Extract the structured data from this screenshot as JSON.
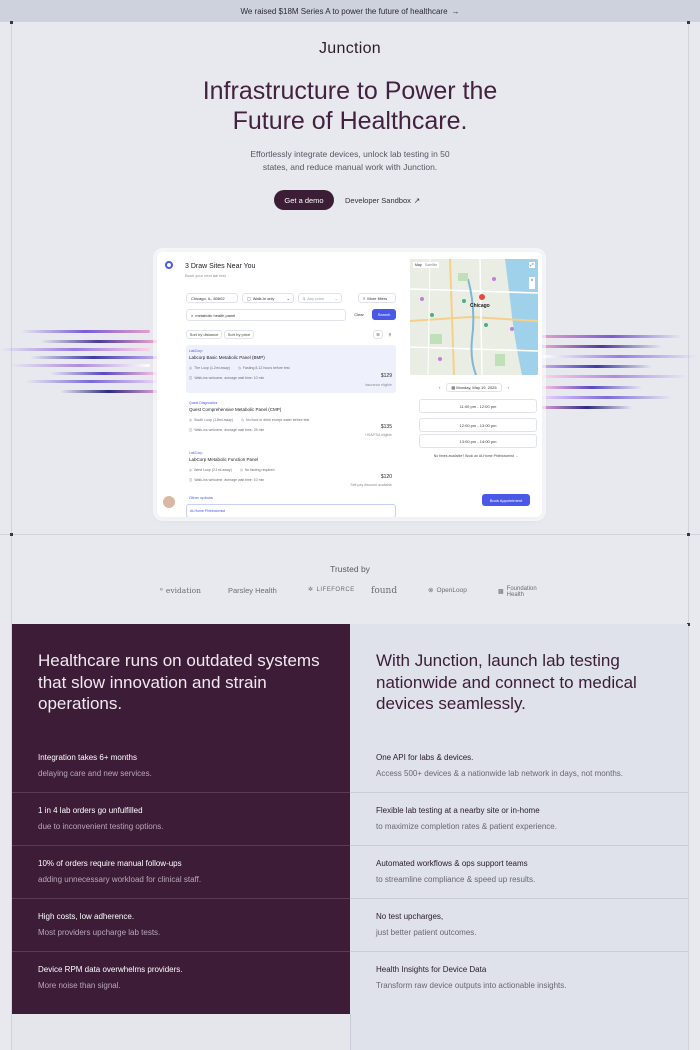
{
  "announcement": {
    "text": "We raised $18M Series A to power the future of healthcare",
    "arrow": "→"
  },
  "header": {
    "logo": "Junction"
  },
  "hero": {
    "title_line1": "Infrastructure to Power the",
    "title_line2": "Future of Healthcare.",
    "sub_line1": "Effortlessly integrate devices, unlock lab testing in 50",
    "sub_line2": "states, and reduce manual work with Junction.",
    "demo_label": "Get a demo",
    "sandbox_label": "Developer Sandbox",
    "sandbox_arrow": "↗"
  },
  "app": {
    "title": "3 Draw Sites Near You",
    "subtitle": "Book your next lab test",
    "location": "Chicago, IL, 60602",
    "walkin": "Walk-in only",
    "price": "Any price",
    "more_filters": "More filters",
    "search_value": "metabolic health panel",
    "clear_label": "Clear",
    "search_label": "Search",
    "sort_distance": "Sort by distance",
    "sort_price": "Sort by price",
    "results": [
      {
        "lab": "LabCorp",
        "name": "Labcorp Basic Metabolic Panel (BMP)",
        "distance": "The Loop (1.2mi away)",
        "req": "Fasting 8-12 hours before test",
        "wait": "Walk-ins welcome, average wait time: 10 min",
        "price": "$129",
        "note": "Insurance eligible"
      },
      {
        "lab": "Quest Diagnostics",
        "name": "Quest Comprehensive Metabolic Panel (CMP)",
        "distance": "South Loop (1.8mi away)",
        "req": "No food or drink except water before test",
        "wait": "Walk-ins welcome, average wait time: 25 min",
        "price": "$135",
        "note": "HSA/FSA eligible"
      },
      {
        "lab": "LabCorp",
        "name": "LabCorp Metabolic Function Panel",
        "distance": "West Loop (2.1mi away)",
        "req": "No fasting required",
        "wait": "Walk-ins welcome, average wait time: 10 min",
        "price": "$120",
        "note": "Self-pay discount available"
      }
    ],
    "other_options": "Other options",
    "at_home": "At-Home Phlebotomist",
    "map_label": "Chicago",
    "map_tab1": "Map",
    "map_tab2": "Satellite",
    "date": "Monday, May 19, 2025",
    "slots": [
      "11:00 pm - 12:00 pm",
      "12:00 pm - 13:00 pm",
      "13:00 pm - 14:00 pm"
    ],
    "no_times": "No times available? Book an At-Home Phlebotomist →",
    "book_label": "Book Appointment"
  },
  "trusted": {
    "label": "Trusted by",
    "brands": [
      "evidation",
      "Parsley Health",
      "LIFEFORCE",
      "found",
      "OpenLoop",
      "Foundation Health"
    ]
  },
  "comparison": {
    "left_heading": "Healthcare runs on outdated systems that slow innovation and strain operations.",
    "right_heading": "With Junction, launch lab testing nationwide and connect to medical devices seamlessly.",
    "left_rows": [
      {
        "title": "Integration takes 6+ months",
        "sub": "delaying care and new services."
      },
      {
        "title": "1 in 4 lab orders go unfulfilled",
        "sub": "due to inconvenient testing options."
      },
      {
        "title": "10% of orders require manual follow-ups",
        "sub": "adding unnecessary workload for clinical staff."
      },
      {
        "title": "High costs, low adherence.",
        "sub": "Most providers upcharge lab tests."
      },
      {
        "title": "Device RPM data overwhelms providers.",
        "sub": "More noise than signal."
      }
    ],
    "right_rows": [
      {
        "title": "One API for labs & devices.",
        "sub": "Access 500+ devices & a nationwide lab network in days, not months."
      },
      {
        "title": "Flexible lab testing at a nearby site or in-home",
        "sub": "to maximize completion rates & patient experience."
      },
      {
        "title": "Automated workflows & ops support teams",
        "sub": "to streamline compliance & speed up results."
      },
      {
        "title": "No test upcharges,",
        "sub": "just better patient outcomes."
      },
      {
        "title": "Health Insights for Device Data",
        "sub": "Transform raw device outputs into actionable insights."
      }
    ]
  }
}
